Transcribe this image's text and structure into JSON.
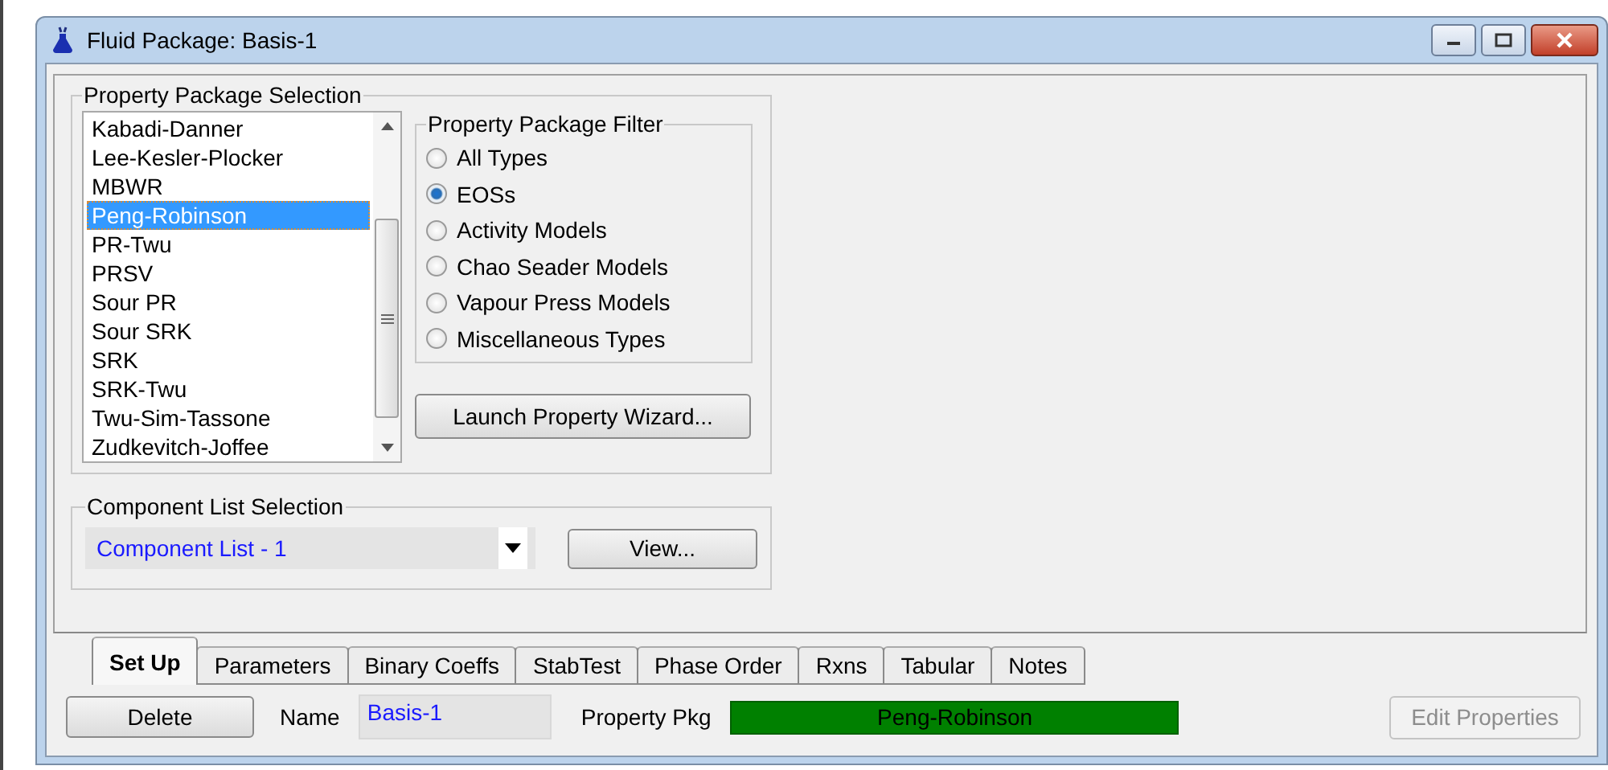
{
  "window": {
    "title": "Fluid Package: Basis-1"
  },
  "property_package_selection": {
    "title": "Property Package Selection",
    "packages": [
      {
        "label": "Kabadi-Danner",
        "selected": false
      },
      {
        "label": "Lee-Kesler-Plocker",
        "selected": false
      },
      {
        "label": "MBWR",
        "selected": false
      },
      {
        "label": "Peng-Robinson",
        "selected": true
      },
      {
        "label": "PR-Twu",
        "selected": false
      },
      {
        "label": "PRSV",
        "selected": false
      },
      {
        "label": "Sour PR",
        "selected": false
      },
      {
        "label": "Sour SRK",
        "selected": false
      },
      {
        "label": "SRK",
        "selected": false
      },
      {
        "label": "SRK-Twu",
        "selected": false
      },
      {
        "label": "Twu-Sim-Tassone",
        "selected": false
      },
      {
        "label": "Zudkevitch-Joffee",
        "selected": false
      }
    ],
    "filter": {
      "title": "Property Package Filter",
      "options": [
        {
          "label": "All Types",
          "selected": false
        },
        {
          "label": "EOSs",
          "selected": true
        },
        {
          "label": "Activity Models",
          "selected": false
        },
        {
          "label": "Chao Seader Models",
          "selected": false
        },
        {
          "label": "Vapour Press Models",
          "selected": false
        },
        {
          "label": "Miscellaneous Types",
          "selected": false
        }
      ]
    },
    "wizard_button": "Launch Property Wizard..."
  },
  "component_list_selection": {
    "title": "Component List Selection",
    "value": "Component List - 1",
    "view_button": "View..."
  },
  "tabs": [
    {
      "label": "Set Up",
      "selected": true
    },
    {
      "label": "Parameters",
      "selected": false
    },
    {
      "label": "Binary Coeffs",
      "selected": false
    },
    {
      "label": "StabTest",
      "selected": false
    },
    {
      "label": "Phase Order",
      "selected": false
    },
    {
      "label": "Rxns",
      "selected": false
    },
    {
      "label": "Tabular",
      "selected": false
    },
    {
      "label": "Notes",
      "selected": false
    }
  ],
  "footer": {
    "delete_button": "Delete",
    "name_label": "Name",
    "name_value": "Basis-1",
    "property_pkg_label": "Property Pkg",
    "property_pkg_value": "Peng-Robinson",
    "edit_button": {
      "label": "Edit Properties",
      "disabled": true
    }
  }
}
